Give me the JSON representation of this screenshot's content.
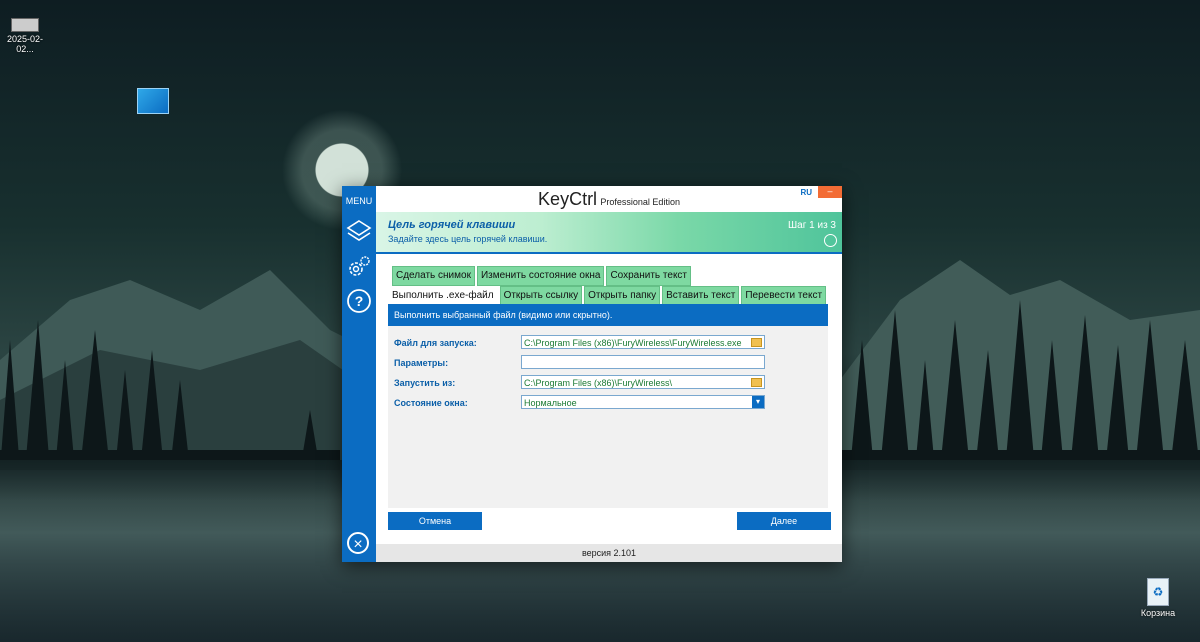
{
  "desktop": {
    "top_icon_label": "2025-02-02...",
    "recycle_label": "Корзина"
  },
  "app": {
    "menu_label": "MENU",
    "title": "KeyCtrl",
    "title_sub": "Professional Edition",
    "lang": "RU",
    "minimize": "–",
    "banner": {
      "heading": "Цель горячей клавиши",
      "desc": "Задайте здесь цель горячей клавиши.",
      "step": "Шаг 1 из 3"
    },
    "tabs_row1": [
      "Сделать снимок",
      "Изменить состояние окна",
      "Сохранить текст"
    ],
    "tabs_row2": [
      "Выполнить .exe-файл",
      "Открыть ссылку",
      "Открыть папку",
      "Вставить текст",
      "Перевести текст"
    ],
    "panel_desc": "Выполнить выбранный файл (видимо или скрытно).",
    "fields": {
      "file_label": "Файл для запуска:",
      "file_value": "C:\\Program Files (x86)\\FuryWireless\\FuryWireless.exe",
      "params_label": "Параметры:",
      "params_value": "",
      "startin_label": "Запустить из:",
      "startin_value": "C:\\Program Files (x86)\\FuryWireless\\",
      "window_label": "Состояние окна:",
      "window_value": "Нормальное"
    },
    "cancel": "Отмена",
    "next": "Далее",
    "version": "версия 2.101"
  }
}
